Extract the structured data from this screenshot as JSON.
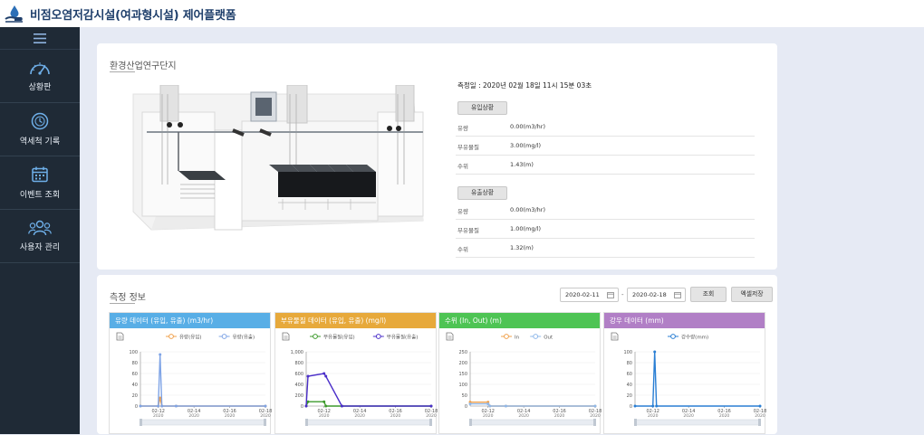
{
  "app": {
    "title": "비점오염저감시설(여과형시설) 제어플랫폼"
  },
  "sidebar": {
    "items": [
      {
        "label": "상황판",
        "icon": "gauge-icon"
      },
      {
        "label": "역세척 기록",
        "icon": "clock-icon"
      },
      {
        "label": "이벤트 조회",
        "icon": "calendar-icon"
      },
      {
        "label": "사용자 관리",
        "icon": "users-icon"
      }
    ]
  },
  "site": {
    "title": "환경산업연구단지",
    "measure_date": "측정일 : 2020년 02월 18일 11시 15분 03초",
    "inflow": {
      "label": "유입상황",
      "rows": [
        {
          "key": "유량",
          "value": "0.00(m3/hr)"
        },
        {
          "key": "부유물질",
          "value": "3.00(mg/l)"
        },
        {
          "key": "수위",
          "value": "1.43(m)"
        }
      ]
    },
    "outflow": {
      "label": "유출상황",
      "rows": [
        {
          "key": "유량",
          "value": "0.00(m3/hr)"
        },
        {
          "key": "부유물질",
          "value": "1.00(mg/l)"
        },
        {
          "key": "수위",
          "value": "1.32(m)"
        }
      ]
    }
  },
  "measure": {
    "title": "측정 정보",
    "date_from": "2020-02-11",
    "date_to": "2020-02-18",
    "dash": "-",
    "search_label": "조회",
    "excel_label": "엑셀저장"
  },
  "colors": {
    "flow": "#58aee6",
    "ss": "#e7a93b",
    "level": "#4ec454",
    "rain": "#b17fc6"
  },
  "chart_data": [
    {
      "type": "line",
      "title": "유량 데이터 (유입, 유출) (m3/hr)",
      "color": "#58aee6",
      "ylim": [
        0,
        100
      ],
      "yticks": [
        "100",
        "80",
        "60",
        "40",
        "20",
        "0"
      ],
      "xticks": [
        "02-12",
        "02-14",
        "02-16",
        "02-18"
      ],
      "xsub": [
        "2020",
        "2020",
        "2020",
        "2020"
      ],
      "series": [
        {
          "name": "유량(유입)",
          "color": "#f0a04b",
          "x": [
            "02-11",
            "02-12",
            "02-12",
            "02-12",
            "02-13",
            "02-18"
          ],
          "values": [
            0,
            0,
            15,
            0,
            0,
            0
          ]
        },
        {
          "name": "유량(유출)",
          "color": "#7fa4e6",
          "x": [
            "02-11",
            "02-12",
            "02-12",
            "02-12",
            "02-13",
            "02-18"
          ],
          "values": [
            0,
            0,
            95,
            0,
            0,
            0
          ]
        }
      ]
    },
    {
      "type": "line",
      "title": "부유물질 데이터 (유입, 유출) (mg/l)",
      "color": "#e7a93b",
      "ylim": [
        0,
        1000
      ],
      "yticks": [
        "1,000",
        "800",
        "600",
        "400",
        "200",
        "0"
      ],
      "xticks": [
        "02-12",
        "02-14",
        "02-16",
        "02-18"
      ],
      "xsub": [
        "2020",
        "2020",
        "2020",
        "2020"
      ],
      "series": [
        {
          "name": "부유물질(유입)",
          "color": "#3d9a2c",
          "x": [
            "02-11",
            "02-11",
            "02-12",
            "02-12",
            "02-13",
            "02-18"
          ],
          "values": [
            0,
            80,
            80,
            0,
            0,
            0
          ]
        },
        {
          "name": "부유물질(유출)",
          "color": "#4b2fc9",
          "x": [
            "02-11",
            "02-11",
            "02-12",
            "02-12",
            "02-13",
            "02-18"
          ],
          "values": [
            0,
            550,
            600,
            550,
            0,
            0
          ]
        }
      ]
    },
    {
      "type": "line",
      "title": "수위 (In, Out) (m)",
      "color": "#4ec454",
      "ylim": [
        0,
        250
      ],
      "yticks": [
        "250",
        "200",
        "150",
        "100",
        "50",
        "0"
      ],
      "xticks": [
        "02-12",
        "02-14",
        "02-16",
        "02-18"
      ],
      "xsub": [
        "2020",
        "2020",
        "2020",
        "2020"
      ],
      "series": [
        {
          "name": "In",
          "color": "#f0a04b",
          "x": [
            "02-11",
            "02-12",
            "02-12",
            "02-13",
            "02-18"
          ],
          "values": [
            18,
            18,
            0,
            0,
            0
          ]
        },
        {
          "name": "Out",
          "color": "#8fb8ea",
          "x": [
            "02-11",
            "02-12",
            "02-12",
            "02-13",
            "02-18"
          ],
          "values": [
            10,
            10,
            0,
            0,
            0
          ]
        }
      ]
    },
    {
      "type": "line",
      "title": "강우 데이터 (mm)",
      "color": "#b17fc6",
      "ylim": [
        0,
        100
      ],
      "yticks": [
        "100",
        "80",
        "60",
        "40",
        "20",
        "0"
      ],
      "xticks": [
        "02-12",
        "02-14",
        "02-16",
        "02-18"
      ],
      "xsub": [
        "2020",
        "2020",
        "2020",
        "2020"
      ],
      "series": [
        {
          "name": "강수량(mm)",
          "color": "#2a7fd4",
          "x": [
            "02-11",
            "02-12",
            "02-12",
            "02-12",
            "02-18"
          ],
          "values": [
            0,
            0,
            100,
            0,
            0
          ]
        }
      ]
    }
  ]
}
